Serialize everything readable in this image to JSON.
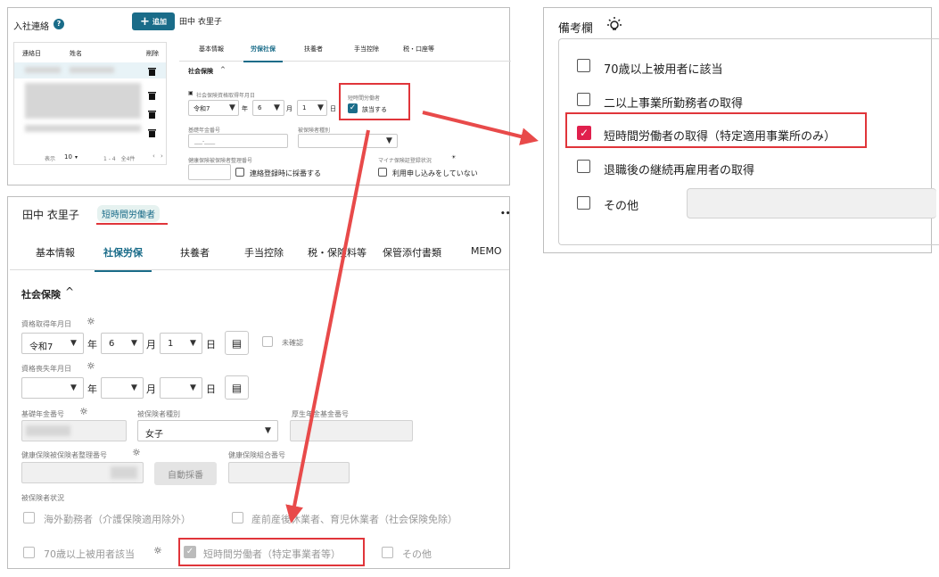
{
  "top_left": {
    "list_title": "入社連絡",
    "help_icon": "?",
    "add_button": "追加",
    "add_icon": "+",
    "employee_name": "田中 衣里子",
    "columns": [
      "連絡日",
      "姓名",
      "削除"
    ],
    "tabs": [
      "基本情報",
      "労保社保",
      "扶養者",
      "手当控除",
      "税・口座等"
    ],
    "section_title": "社会保険",
    "acquire_date_label": "社会保険資格取得年月日",
    "era": "令和7",
    "year_unit": "年",
    "month": "6",
    "month_unit": "月",
    "day": "1",
    "day_unit": "日",
    "short_time_label": "短時間労働者",
    "short_time_checkbox": "該当する",
    "pension_no_label": "基礎年金番号",
    "pension_no_value": "___-____",
    "insured_type_label": "被保険者種別",
    "health_no_label": "健康保険被保険者整理番号",
    "auto_number_checkbox": "連絡登録時に採番する",
    "myna_label": "マイナ保険証登録状況",
    "myna_checkbox": "利用申し込みをしていない",
    "pager_show": "表示",
    "pager_size": "10",
    "pager_range": "1 - 4　全4件"
  },
  "right": {
    "title": "備考欄",
    "options": [
      {
        "label": "70歳以上被用者に該当",
        "checked": false
      },
      {
        "label": "二以上事業所勤務者の取得",
        "checked": false
      },
      {
        "label": "短時間労働者の取得（特定適用事業所のみ）",
        "checked": true
      },
      {
        "label": "退職後の継続再雇用者の取得",
        "checked": false
      },
      {
        "label": "その他",
        "checked": false
      }
    ]
  },
  "bottom": {
    "employee_name": "田中 衣里子",
    "badge": "短時間労働者",
    "more": "••",
    "tabs": [
      "基本情報",
      "社保労保",
      "扶養者",
      "手当控除",
      "税・保険料等",
      "保管添付書類",
      "MEMO"
    ],
    "section_title": "社会保険",
    "acquire_label": "資格取得年月日",
    "era": "令和7",
    "year_unit": "年",
    "month": "6",
    "month_unit": "月",
    "day": "1",
    "day_unit": "日",
    "unconfirmed": "未確認",
    "loss_label": "資格喪失年月日",
    "pension_no_label": "基礎年金番号",
    "insured_type_label": "被保険者種別",
    "insured_type_value": "女子",
    "kousei_label": "厚生年金基金番号",
    "health_no_label": "健康保険被保険者整理番号",
    "auto_number_button": "自動採番",
    "health_union_label": "健康保険組合番号",
    "status_label": "被保険者状況",
    "status_options": [
      "海外勤務者（介護保険適用除外）",
      "産前産後休業者、育児休業者（社会保険免除）",
      "70歳以上被用者該当",
      "短時間労働者（特定事業者等）",
      "その他"
    ]
  },
  "colors": {
    "accent": "#1a6c89",
    "red": "#e0353a",
    "checkbox_pink": "#e0204d"
  }
}
